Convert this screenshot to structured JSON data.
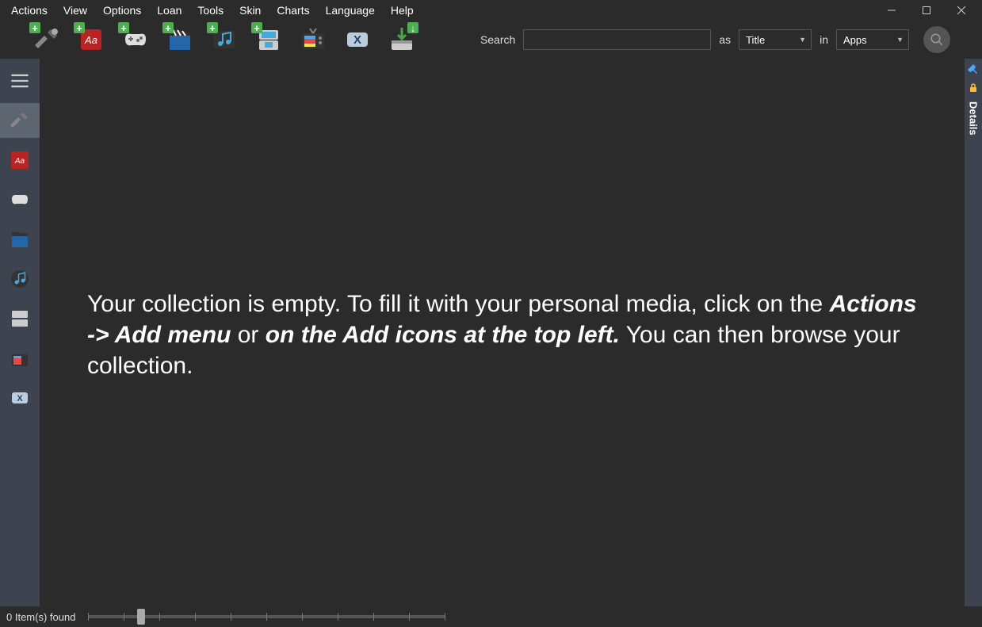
{
  "menubar": {
    "items": [
      "Actions",
      "View",
      "Options",
      "Loan",
      "Tools",
      "Skin",
      "Charts",
      "Language",
      "Help"
    ]
  },
  "toolbar": {
    "icons": [
      {
        "name": "add-tools",
        "title": "Tools"
      },
      {
        "name": "add-books",
        "title": "Books"
      },
      {
        "name": "add-games",
        "title": "Games"
      },
      {
        "name": "add-movies",
        "title": "Movies"
      },
      {
        "name": "add-music",
        "title": "Music"
      },
      {
        "name": "add-nds",
        "title": "Handheld"
      },
      {
        "name": "add-tv",
        "title": "TV"
      },
      {
        "name": "add-x",
        "title": "X"
      },
      {
        "name": "add-download",
        "title": "Download"
      }
    ]
  },
  "search": {
    "label": "Search",
    "value": "",
    "as_label": "as",
    "as_value": "Title",
    "in_label": "in",
    "in_value": "Apps"
  },
  "sidebar_left": {
    "items": [
      {
        "name": "hamburger"
      },
      {
        "name": "tools",
        "active": true
      },
      {
        "name": "books"
      },
      {
        "name": "games"
      },
      {
        "name": "movies"
      },
      {
        "name": "music"
      },
      {
        "name": "handheld"
      },
      {
        "name": "tv"
      },
      {
        "name": "x"
      }
    ]
  },
  "sidebar_right": {
    "details_label": "Details"
  },
  "content": {
    "empty_prefix": "Your collection is empty. To fill it with your personal media, click on the ",
    "empty_bold1": "Actions -> Add menu",
    "empty_mid": " or ",
    "empty_bold2": "on the Add icons at the top left.",
    "empty_suffix": " You can then browse your collection."
  },
  "statusbar": {
    "items_found": "0 Item(s) found"
  }
}
